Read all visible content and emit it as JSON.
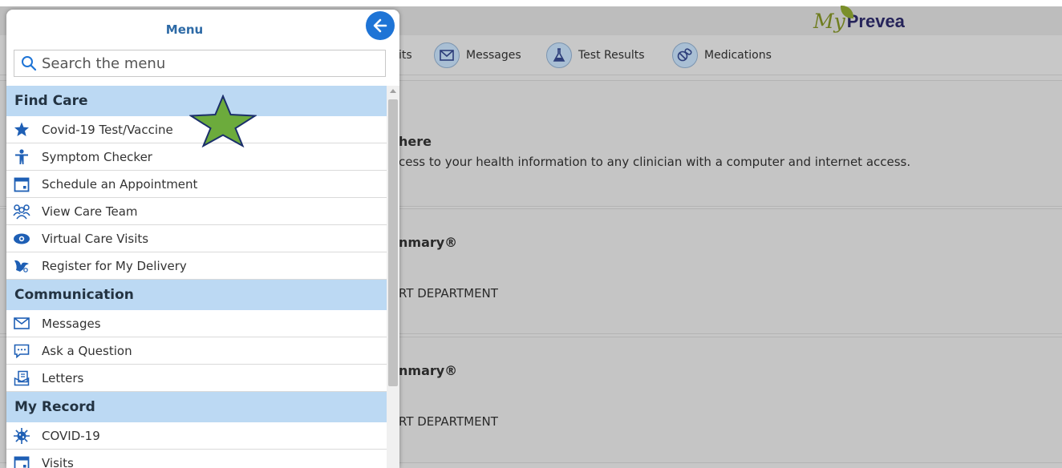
{
  "header": {
    "logo_my": "My",
    "logo_prevea": "Prevea"
  },
  "navbar": {
    "items": [
      {
        "label": "its",
        "icon": "visits-icon"
      },
      {
        "label": "Messages",
        "icon": "envelope-icon"
      },
      {
        "label": "Test Results",
        "icon": "flask-icon"
      },
      {
        "label": "Medications",
        "icon": "pill-icon"
      }
    ]
  },
  "cards": [
    {
      "title": "here",
      "text": "cess to your health information to any clinician with a computer and internet access."
    },
    {
      "title": "nmary®",
      "text": "RT DEPARTMENT"
    },
    {
      "title": "nmary®",
      "text": "RT DEPARTMENT"
    }
  ],
  "menu": {
    "title": "Menu",
    "search_placeholder": "Search the menu",
    "sections": [
      {
        "label": "Find Care",
        "items": [
          {
            "label": "Covid-19 Test/Vaccine",
            "icon": "star-icon"
          },
          {
            "label": "Symptom Checker",
            "icon": "person-icon"
          },
          {
            "label": "Schedule an Appointment",
            "icon": "calendar-icon"
          },
          {
            "label": "View Care Team",
            "icon": "care-team-icon"
          },
          {
            "label": "Virtual Care Visits",
            "icon": "video-icon"
          },
          {
            "label": "Register for My Delivery",
            "icon": "stork-icon"
          }
        ]
      },
      {
        "label": "Communication",
        "items": [
          {
            "label": "Messages",
            "icon": "envelope-icon"
          },
          {
            "label": "Ask a Question",
            "icon": "chat-icon"
          },
          {
            "label": "Letters",
            "icon": "letters-icon"
          }
        ]
      },
      {
        "label": "My Record",
        "items": [
          {
            "label": "COVID-19",
            "icon": "virus-icon"
          },
          {
            "label": "Visits",
            "icon": "calendar-icon"
          }
        ]
      }
    ]
  },
  "colors": {
    "accent": "#1e74d6",
    "section_bg": "#bcd9f3",
    "annotation_star": "#6cab3c"
  }
}
